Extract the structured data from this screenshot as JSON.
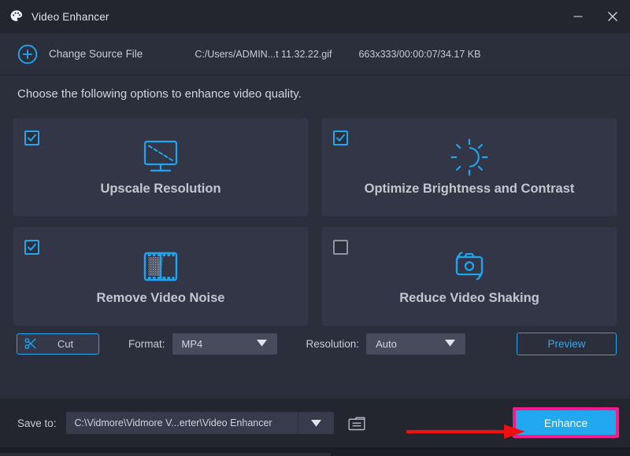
{
  "window": {
    "title": "Video Enhancer",
    "icon": "palette-icon",
    "minimize_label": "Minimize",
    "close_label": "Close"
  },
  "source_bar": {
    "change_source_label": "Change Source File",
    "add_icon": "plus-circle-icon",
    "file_path": "C:/Users/ADMIN...t 11.32.22.gif",
    "file_meta": "663x333/00:00:07/34.17 KB"
  },
  "main": {
    "heading": "Choose the following options to enhance video quality.",
    "options": [
      {
        "label": "Upscale Resolution",
        "checked": true,
        "icon": "monitor-upscale-icon"
      },
      {
        "label": "Optimize Brightness and Contrast",
        "checked": true,
        "icon": "brightness-sun-icon"
      },
      {
        "label": "Remove Video Noise",
        "checked": true,
        "icon": "film-strip-noise-icon"
      },
      {
        "label": "Reduce Video Shaking",
        "checked": false,
        "icon": "camera-shake-icon"
      }
    ]
  },
  "toolbar": {
    "cut_label": "Cut",
    "cut_icon": "scissors-icon",
    "format_label": "Format:",
    "format_value": "MP4",
    "resolution_label": "Resolution:",
    "resolution_value": "Auto",
    "preview_label": "Preview",
    "caret_icon": "chevron-down-icon"
  },
  "bottom_bar": {
    "save_to_label": "Save to:",
    "save_to_path": "C:\\Vidmore\\Vidmore V...erter\\Video Enhancer",
    "dropdown_icon": "chevron-down-icon",
    "folder_icon": "folder-browse-icon",
    "enhance_label": "Enhance"
  },
  "annotation": {
    "arrow": "red-arrow-pointing-right",
    "highlight_color": "#f41c8c",
    "arrow_color": "#ee1111"
  },
  "colors": {
    "accent": "#21a8ef",
    "window_bg": "#2b2e3b",
    "bar_bg": "#23252f",
    "card_bg": "#323646",
    "text": "#c9ccd6"
  }
}
